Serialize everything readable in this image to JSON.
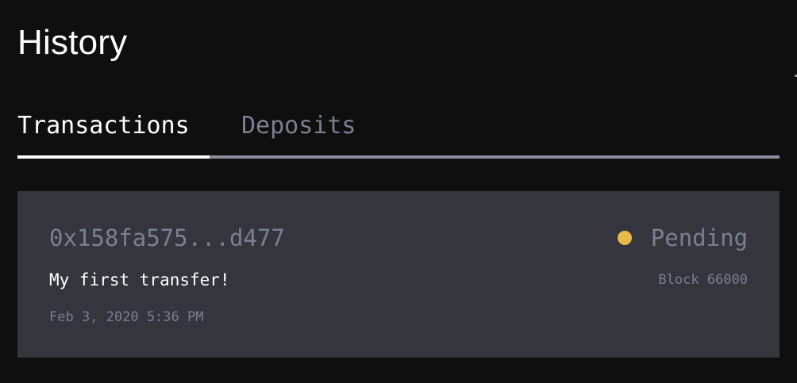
{
  "page": {
    "title": "History"
  },
  "tabs": [
    {
      "label": "Transactions",
      "active": true
    },
    {
      "label": "Deposits",
      "active": false
    }
  ],
  "transactions": [
    {
      "hash": "0x158fa575...d477",
      "note": "My first transfer!",
      "date": "Feb 3, 2020 5:36 PM",
      "status": "Pending",
      "status_color": "#e9b949",
      "block": "Block 66000"
    }
  ],
  "colors": {
    "background": "#0f0f10",
    "card": "#35353e",
    "muted_text": "#7a7f92",
    "active_text": "#ffffff",
    "tab_track": "#8a8d9c"
  }
}
